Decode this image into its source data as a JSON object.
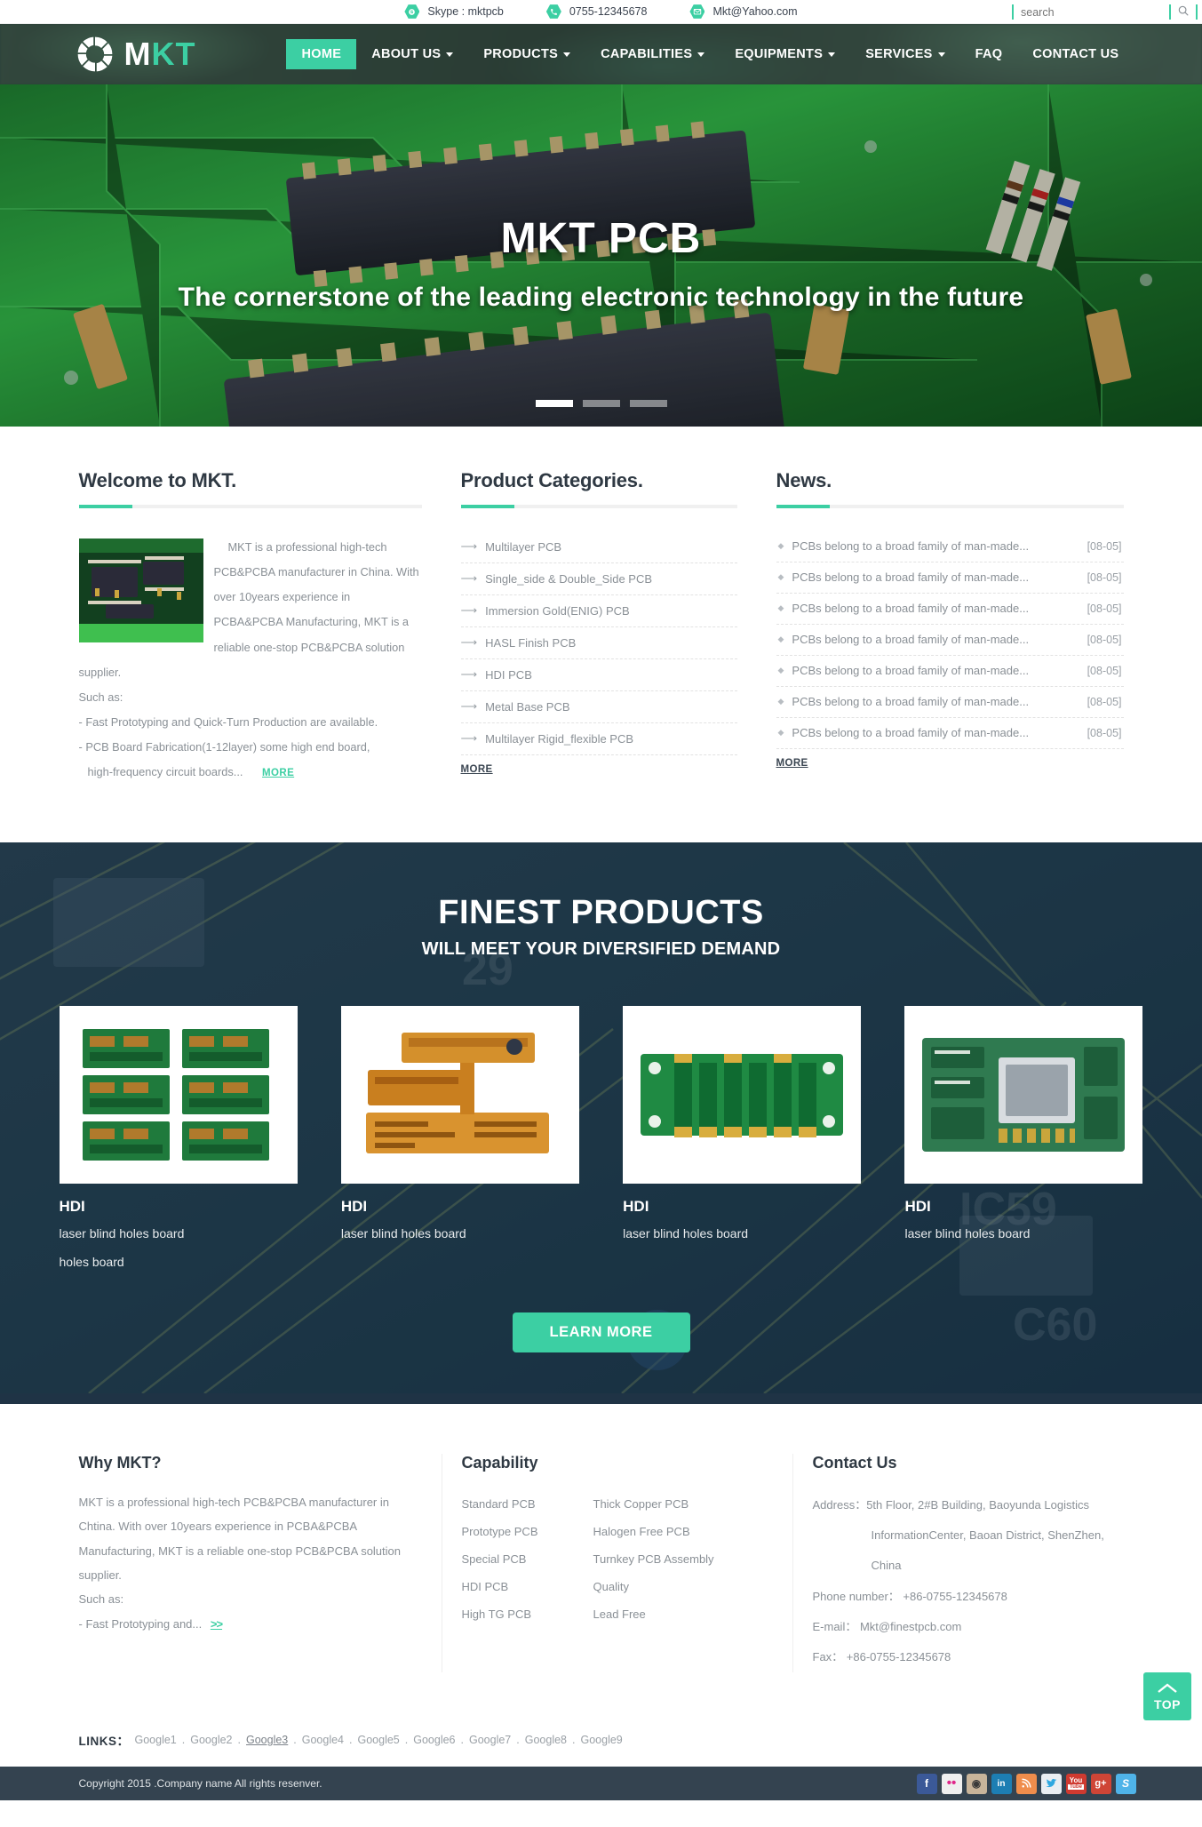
{
  "topbar": {
    "contacts": [
      {
        "icon": "skype-icon",
        "label": "Skype : mktpcb"
      },
      {
        "icon": "phone-icon",
        "label": "0755-12345678"
      },
      {
        "icon": "mail-icon",
        "label": "Mkt@Yahoo.com"
      }
    ],
    "search": {
      "placeholder": "search",
      "value": "",
      "icon": "search-icon"
    }
  },
  "header": {
    "logo_text": "MKT",
    "nav": [
      {
        "label": "HOME",
        "active": true,
        "dropdown": false
      },
      {
        "label": "ABOUT US",
        "active": false,
        "dropdown": true
      },
      {
        "label": "PRODUCTS",
        "active": false,
        "dropdown": true
      },
      {
        "label": "CAPABILITIES",
        "active": false,
        "dropdown": true
      },
      {
        "label": "EQUIPMENTS",
        "active": false,
        "dropdown": true
      },
      {
        "label": "SERVICES",
        "active": false,
        "dropdown": true
      },
      {
        "label": "FAQ",
        "active": false,
        "dropdown": false
      },
      {
        "label": "CONTACT US",
        "active": false,
        "dropdown": false
      }
    ]
  },
  "hero": {
    "title": "MKT PCB",
    "subtitle": "The cornerstone of the leading electronic technology in the future",
    "slides": 3,
    "active_slide": 1
  },
  "welcome": {
    "title": "Welcome to MKT.",
    "paragraph": "MKT is a professional high-tech PCB&PCBA manufacturer in China. With over 10years experience in PCBA&PCBA Manufacturing, MKT is a reliable one-stop PCB&PCBA solution supplier.",
    "such_as": "Such as:",
    "line1": "- Fast Prototyping and Quick-Turn Production are available.",
    "line2": "- PCB Board Fabrication(1-12layer) some high end board,",
    "line3": "high-frequency circuit boards...",
    "more": "MORE"
  },
  "categories": {
    "title": "Product Categories.",
    "items": [
      "Multilayer PCB",
      "Single_side & Double_Side PCB",
      "Immersion Gold(ENIG) PCB",
      "HASL Finish PCB",
      "HDI PCB",
      "Metal Base PCB",
      "Multilayer Rigid_flexible PCB"
    ],
    "more": "MORE"
  },
  "news": {
    "title": "News.",
    "items": [
      {
        "title": "PCBs belong to a broad family of man-made...",
        "date": "[08-05]"
      },
      {
        "title": "PCBs belong to a broad family of man-made...",
        "date": "[08-05]"
      },
      {
        "title": "PCBs belong to a broad family of man-made...",
        "date": "[08-05]"
      },
      {
        "title": "PCBs belong to a broad family of man-made...",
        "date": "[08-05]"
      },
      {
        "title": "PCBs belong to a broad family of man-made...",
        "date": "[08-05]"
      },
      {
        "title": "PCBs belong to a broad family of man-made...",
        "date": "[08-05]"
      },
      {
        "title": "PCBs belong to a broad family of man-made...",
        "date": "[08-05]"
      }
    ],
    "more": "MORE"
  },
  "finest": {
    "heading": "FINEST PRODUCTS",
    "subheading": "WILL MEET YOUR DIVERSIFIED DEMAND",
    "products": [
      {
        "name": "HDI",
        "desc": "laser blind holes board",
        "desc2": "holes board"
      },
      {
        "name": "HDI",
        "desc": "laser blind holes board",
        "desc2": ""
      },
      {
        "name": "HDI",
        "desc": "laser blind holes board",
        "desc2": ""
      },
      {
        "name": "HDI",
        "desc": "laser blind holes board",
        "desc2": ""
      }
    ],
    "cta": "LEARN MORE"
  },
  "footer": {
    "why": {
      "title": "Why MKT?",
      "body": "MKT is a professional high-tech PCB&PCBA manufacturer in Chtina. With over 10years experience in PCBA&PCBA Manufacturing, MKT is a reliable one-stop PCB&PCBA solution supplier.",
      "such_as": "Such as:",
      "last_line": "- Fast Prototyping and...",
      "more": ">>"
    },
    "capability": {
      "title": "Capability",
      "col1": [
        "Standard PCB",
        "Prototype PCB",
        "Special PCB",
        "HDI PCB",
        "High TG PCB"
      ],
      "col2": [
        "Thick Copper PCB",
        "Halogen Free PCB",
        "Turnkey PCB Assembly",
        "Quality",
        "Lead Free"
      ]
    },
    "contact": {
      "title": "Contact Us",
      "address_label": "Address：",
      "address_line1": "5th Floor, 2#B Building, Baoyunda Logistics",
      "address_line2": "InformationCenter, Baoan District, ShenZhen,",
      "address_line3": "China",
      "phone": "Phone number：  +86-0755-12345678",
      "email": "E-mail：  Mkt@finestpcb.com",
      "fax": "Fax：  +86-0755-12345678"
    },
    "links": {
      "label": "LINKS：",
      "items": [
        "Google1",
        "Google2",
        "Google3",
        "Google4",
        "Google5",
        "Google6",
        "Google7",
        "Google8",
        "Google9"
      ],
      "hover_index": 2,
      "separator": "."
    },
    "top_button": "TOP",
    "copyright": "Copyright 2015 .Company name All rights resenver.",
    "socials": [
      {
        "name": "facebook-icon",
        "glyph": "f",
        "color": "#3b5998"
      },
      {
        "name": "flickr-icon",
        "glyph": "••",
        "color": "#efefef"
      },
      {
        "name": "instagram-icon",
        "glyph": "◉",
        "color": "#c8b49a"
      },
      {
        "name": "linkedin-icon",
        "glyph": "in",
        "color": "#1d7eb3"
      },
      {
        "name": "rss-icon",
        "glyph": "≫",
        "color": "#ef8d4c"
      },
      {
        "name": "twitter-icon",
        "glyph": "t",
        "color": "#e9eef2"
      },
      {
        "name": "youtube-icon",
        "glyph": "▶",
        "color": "#cf3a30"
      },
      {
        "name": "googleplus-icon",
        "glyph": "g+",
        "color": "#cf4536"
      },
      {
        "name": "skype-icon",
        "glyph": "S",
        "color": "#4fb3e8"
      }
    ]
  },
  "colors": {
    "accent": "#3ccfa3",
    "header_bg": "#2b4038",
    "dark_text": "#2f3943",
    "body_text": "#8a9096",
    "copybar_bg": "#344350"
  }
}
